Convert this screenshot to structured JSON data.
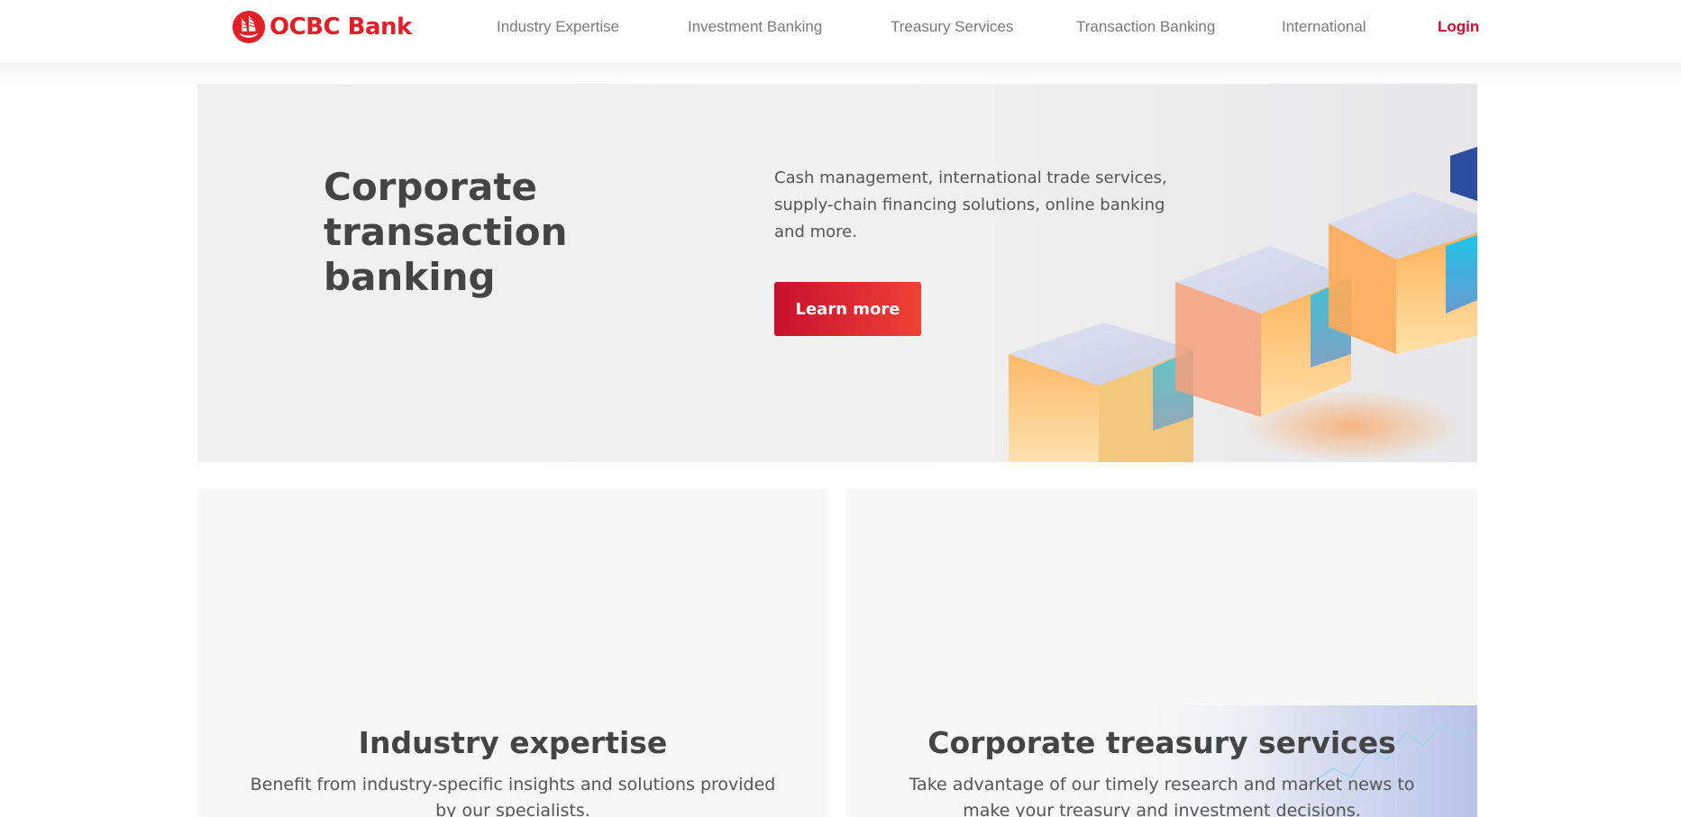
{
  "brand": {
    "name": "OCBC Bank",
    "color": "#e21f26",
    "icon": "ocbc-sailing-junk-logo-icon"
  },
  "nav": {
    "items": [
      {
        "label": "Industry Expertise"
      },
      {
        "label": "Investment Banking"
      },
      {
        "label": "Treasury Services"
      },
      {
        "label": "Transaction Banking"
      },
      {
        "label": "International"
      }
    ],
    "login_label": "Login"
  },
  "hero": {
    "title": "Corporate transaction banking",
    "description": "Cash management, international trade services, supply-chain financing solutions, online banking and more.",
    "cta_label": "Learn more",
    "image": "glass-cubes-illustration"
  },
  "cards": [
    {
      "title": "Industry expertise",
      "description": "Benefit from industry-specific insights and solutions provided by our specialists."
    },
    {
      "title": "Corporate treasury services",
      "description": "Take advantage of our timely research and market news to make your treasury and investment decisions.",
      "image": "market-chart-illustration"
    }
  ],
  "colors": {
    "accent": "#c8102e",
    "accent_gradient_end": "#ef4135",
    "text": "#444444"
  }
}
